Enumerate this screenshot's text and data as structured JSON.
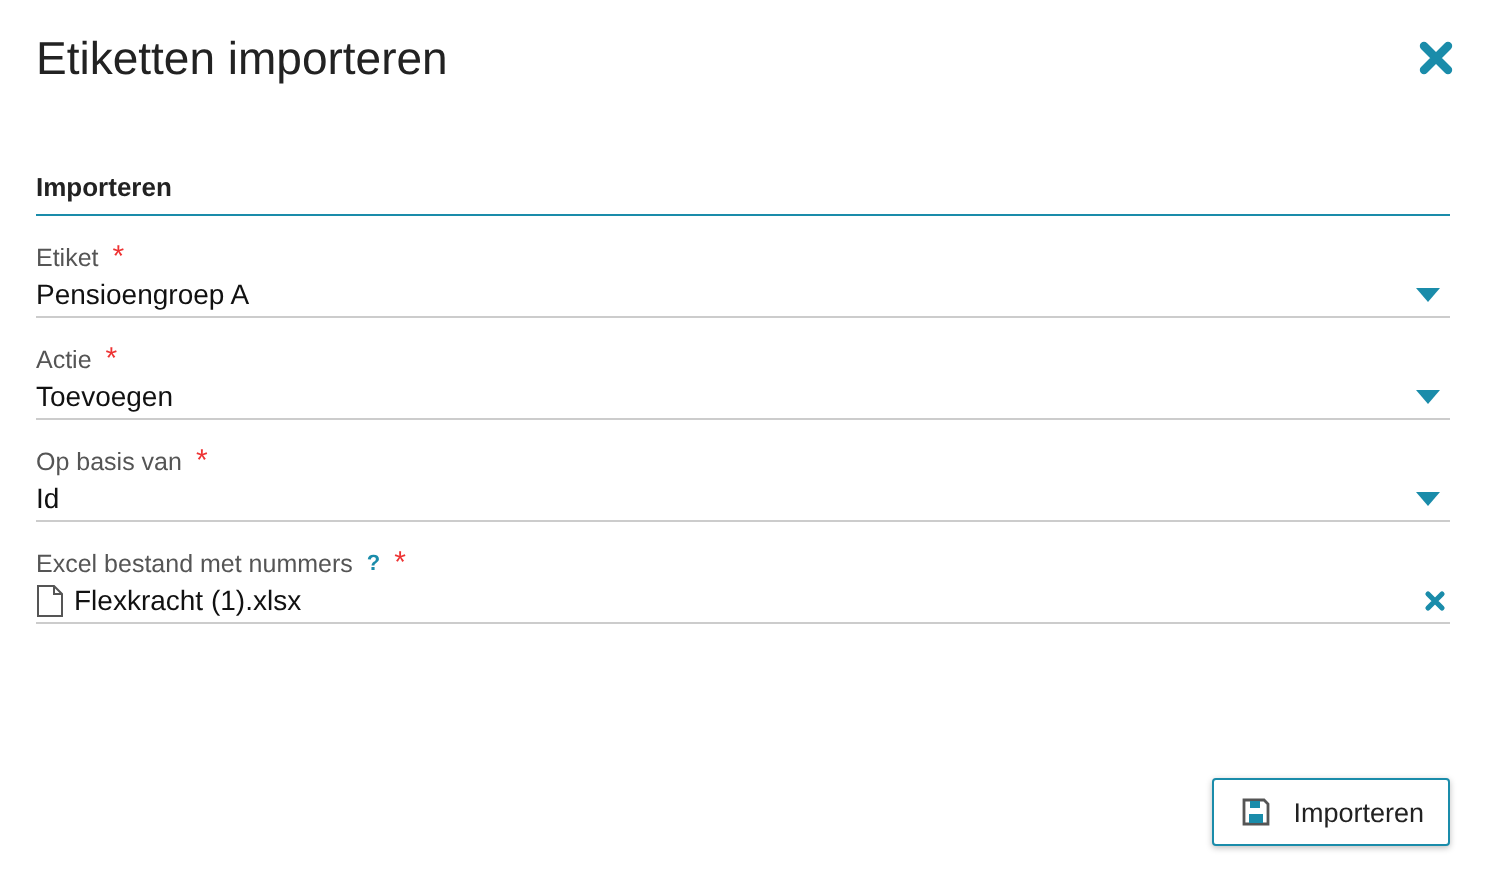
{
  "window": {
    "title": "Etiketten importeren"
  },
  "section": {
    "title": "Importeren"
  },
  "fields": [
    {
      "kind": "select",
      "label": "Etiket",
      "required_mark": "*",
      "value": "Pensioengroep A"
    },
    {
      "kind": "select",
      "label": "Actie",
      "required_mark": "*",
      "value": "Toevoegen"
    },
    {
      "kind": "select",
      "label": "Op basis van",
      "required_mark": "*",
      "value": "Id"
    },
    {
      "kind": "file",
      "label": "Excel bestand met nummers",
      "help": "?",
      "required_mark": "*",
      "value": "Flexkracht (1).xlsx"
    }
  ],
  "buttons": [
    {
      "label": "Importeren"
    }
  ]
}
